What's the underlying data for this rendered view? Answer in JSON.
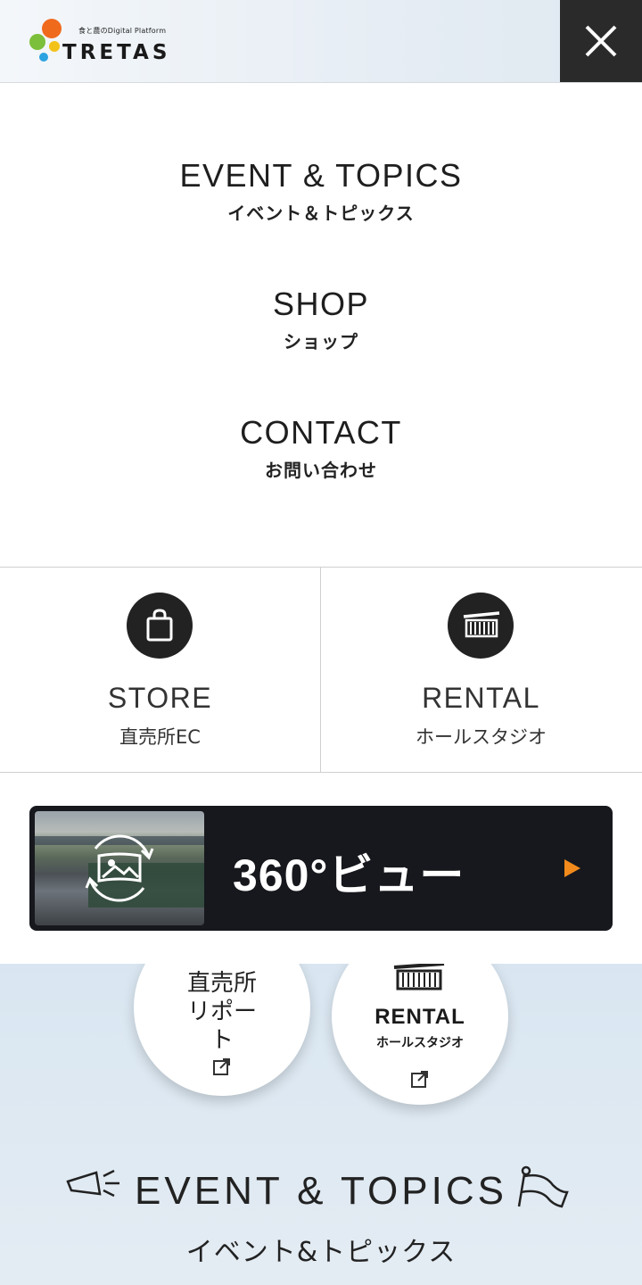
{
  "header": {
    "logo_tagline": "食と農のDigital Platform",
    "logo_wordmark": "TRETAS",
    "brand_colors": {
      "orange": "#f06a1c",
      "green": "#7cbf3a",
      "blue": "#2aa3e0",
      "yellow": "#f3c21a"
    },
    "close_icon": "close-icon"
  },
  "menu": {
    "items": [
      {
        "en": "EVENT & TOPICS",
        "ja": "イベント＆トピックス"
      },
      {
        "en": "SHOP",
        "ja": "ショップ"
      },
      {
        "en": "CONTACT",
        "ja": "お問い合わせ"
      }
    ],
    "tiles": [
      {
        "en": "STORE",
        "ja": "直売所EC",
        "icon": "shopping-bag-icon"
      },
      {
        "en": "RENTAL",
        "ja": "ホールスタジオ",
        "icon": "hall-icon"
      }
    ],
    "banner": {
      "label": "360°ビュー",
      "accent": "#f28a1c",
      "icon": "360-view-icon"
    }
  },
  "background_page": {
    "bubble_report": "直売所リポート",
    "bubble_rental_en": "RENTAL",
    "bubble_rental_ja": "ホールスタジオ",
    "section_title_en": "EVENT & TOPICS",
    "section_title_ja": "イベント&トピックス"
  }
}
